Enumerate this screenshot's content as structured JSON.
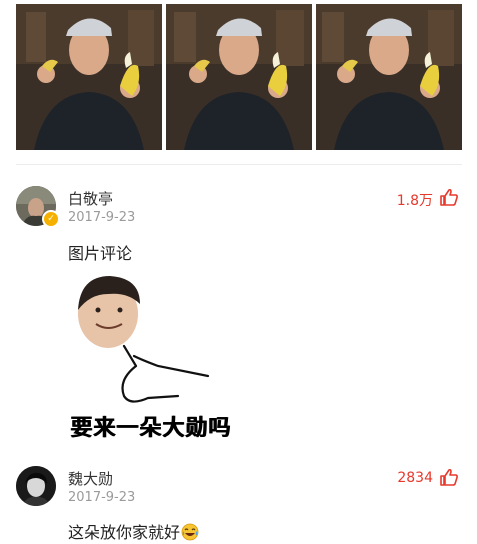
{
  "photos": [
    {
      "icon": "photo-thumbnail"
    },
    {
      "icon": "photo-thumbnail"
    },
    {
      "icon": "photo-thumbnail"
    }
  ],
  "comments": [
    {
      "username": "白敬亭",
      "timestamp": "2017-9-23",
      "likes": "1.8万",
      "verified": true,
      "text": "图片评论",
      "meme_caption": "要来一朵大勋吗"
    },
    {
      "username": "魏大勋",
      "timestamp": "2017-9-23",
      "likes": "2834",
      "verified": false,
      "text": "这朵放你家就好",
      "emoji": "laughing-crying-emoji"
    }
  ],
  "colors": {
    "like": "#e6392c",
    "verified_badge": "#f5b000",
    "timestamp": "#9a9a9a"
  }
}
